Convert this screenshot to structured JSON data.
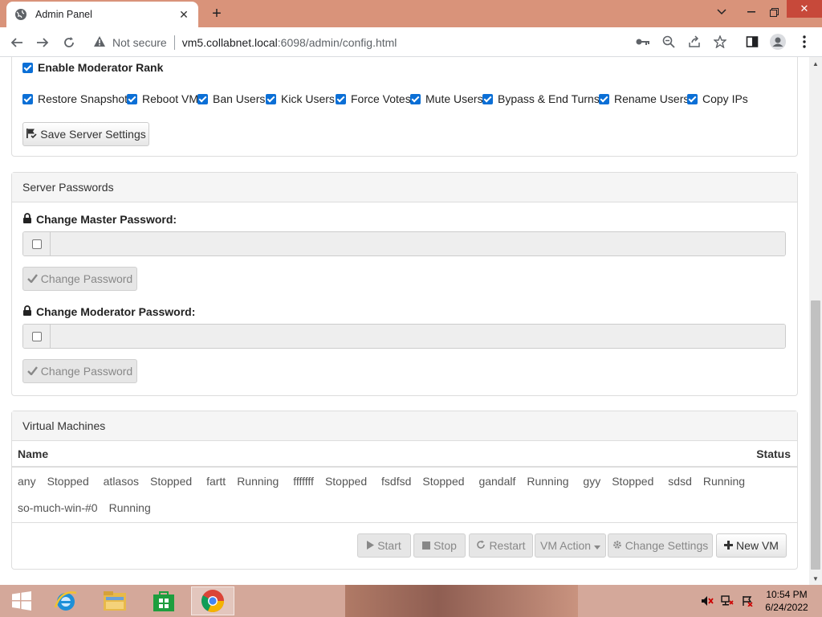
{
  "browser": {
    "tab_title": "Admin Panel",
    "address_security": "Not secure",
    "url_host": "vm5.collabnet.local",
    "url_path": ":6098/admin/config.html"
  },
  "settings": {
    "enable_moderator_rank": "Enable Moderator Rank",
    "permissions": [
      "Restore Snapshot",
      "Reboot VM",
      "Ban Users",
      "Kick Users",
      "Force Votes",
      "Mute Users",
      "Bypass & End Turns",
      "Rename Users",
      "Copy IPs"
    ],
    "save_button": "Save Server Settings"
  },
  "passwords": {
    "title": "Server Passwords",
    "master_label": "Change Master Password:",
    "moderator_label": "Change Moderator Password:",
    "change_button": "Change Password"
  },
  "vms": {
    "title": "Virtual Machines",
    "columns": {
      "name": "Name",
      "status": "Status"
    },
    "rows": [
      [
        {
          "name": "any",
          "status": "Stopped"
        },
        {
          "name": "atlasos",
          "status": "Stopped"
        },
        {
          "name": "fartt",
          "status": "Running"
        },
        {
          "name": "fffffff",
          "status": "Stopped"
        },
        {
          "name": "fsdfsd",
          "status": "Stopped"
        },
        {
          "name": "gandalf",
          "status": "Running"
        },
        {
          "name": "gyy",
          "status": "Stopped"
        },
        {
          "name": "sdsd",
          "status": "Running"
        }
      ],
      [
        {
          "name": "so-much-win-#0",
          "status": "Running"
        }
      ]
    ],
    "actions": {
      "start": "Start",
      "stop": "Stop",
      "restart": "Restart",
      "vm_action": "VM Action",
      "change_settings": "Change Settings",
      "new_vm": "New VM"
    }
  },
  "taskbar": {
    "time": "10:54 PM",
    "date": "6/24/2022"
  }
}
